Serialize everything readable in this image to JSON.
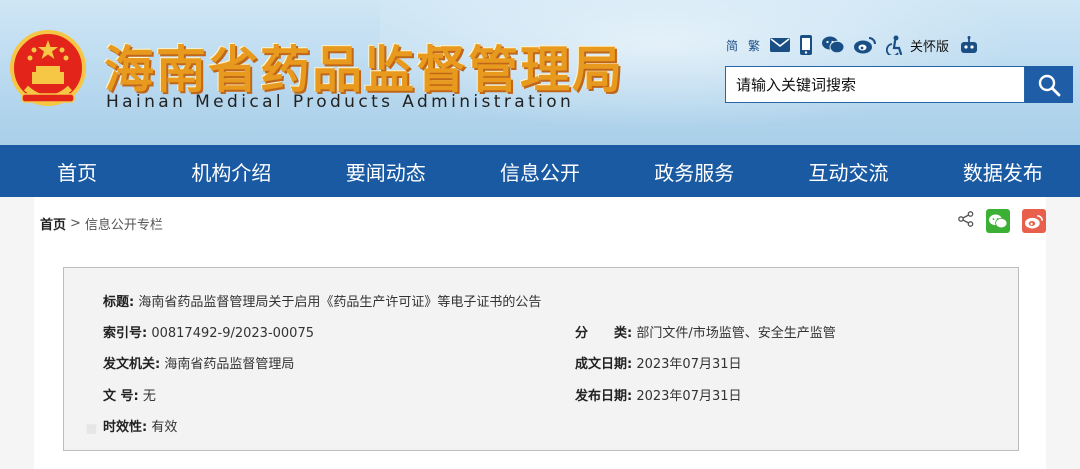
{
  "header": {
    "title_cn": "海南省药品监督管理局",
    "title_en": "Hainan Medical Products Administration",
    "toolbar": {
      "simplified": "简",
      "traditional": "繁",
      "care_mode": "关怀版"
    },
    "search": {
      "placeholder": "请输入关键词搜索"
    }
  },
  "nav": {
    "items": [
      "首页",
      "机构介绍",
      "要闻动态",
      "信息公开",
      "政务服务",
      "互动交流",
      "数据发布"
    ]
  },
  "breadcrumb": {
    "home": "首页",
    "separator": ">",
    "current": "信息公开专栏"
  },
  "meta": {
    "title_label": "标题:",
    "title_value": "海南省药品监督管理局关于启用《药品生产许可证》等电子证书的公告",
    "index_label": "索引号:",
    "index_value": "00817492-9/2023-00075",
    "category_label": "分　　类:",
    "category_value": "部门文件/市场监管、安全生产监管",
    "issuer_label": "发文机关:",
    "issuer_value": "海南省药品监督管理局",
    "date_written_label": "成文日期:",
    "date_written_value": "2023年07月31日",
    "doc_no_label": "文 号:",
    "doc_no_value": "无",
    "publish_label": "发布日期:",
    "publish_value": "2023年07月31日",
    "validity_label": "时效性:",
    "validity_value": "有效"
  },
  "colors": {
    "nav_bg": "#1a5aa3",
    "title_orange": "#e89a1e",
    "wechat_green": "#3cb034",
    "weibo_red": "#e8604c"
  }
}
